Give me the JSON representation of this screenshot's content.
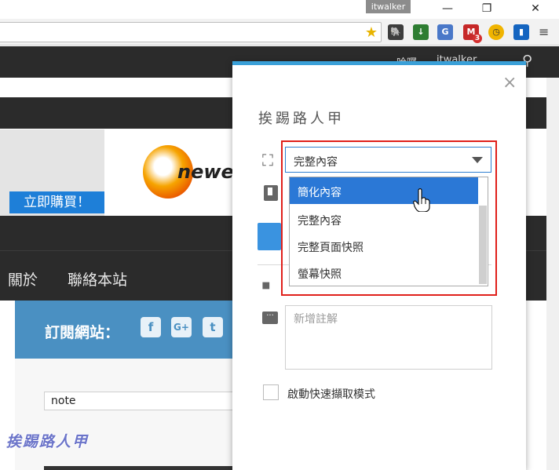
{
  "browser": {
    "user_tag": "itwalker",
    "minimize": "—",
    "maximize": "❐",
    "close": "✕",
    "menu": "≡",
    "extensions": [
      {
        "name": "evernote-icon",
        "glyph": "🐘"
      },
      {
        "name": "clipper-icon",
        "glyph": "↓"
      },
      {
        "name": "translate-icon",
        "glyph": "G"
      },
      {
        "name": "gmail-icon",
        "glyph": "M",
        "badge": "3"
      },
      {
        "name": "clock-icon",
        "glyph": "◷"
      },
      {
        "name": "bookmark-ext-icon",
        "glyph": "▮"
      }
    ]
  },
  "site": {
    "top_mini_1": "哈囉",
    "top_mini_2": "itwalker",
    "buy_button": "立即購買！",
    "logo_text": "newegg",
    "menu_items": [
      "關於",
      "聯絡本站"
    ],
    "subscribe_label": "訂閱網站：",
    "social": [
      "f",
      "G+",
      "t"
    ],
    "note_value": "note",
    "watermark": "挨踢路人甲"
  },
  "panel": {
    "title": "挨踢路人甲",
    "close": "×",
    "selected_option": "完整內容",
    "options": [
      "簡化內容",
      "完整內容",
      "完整頁面快照",
      "螢幕快照"
    ],
    "highlighted_index": 0,
    "notes_placeholder": "新增註解",
    "checkbox_label": "啟動快速擷取模式"
  },
  "colors": {
    "accent": "#3aa0d8",
    "selected": "#2b78d6",
    "frame": "#e0201b"
  }
}
